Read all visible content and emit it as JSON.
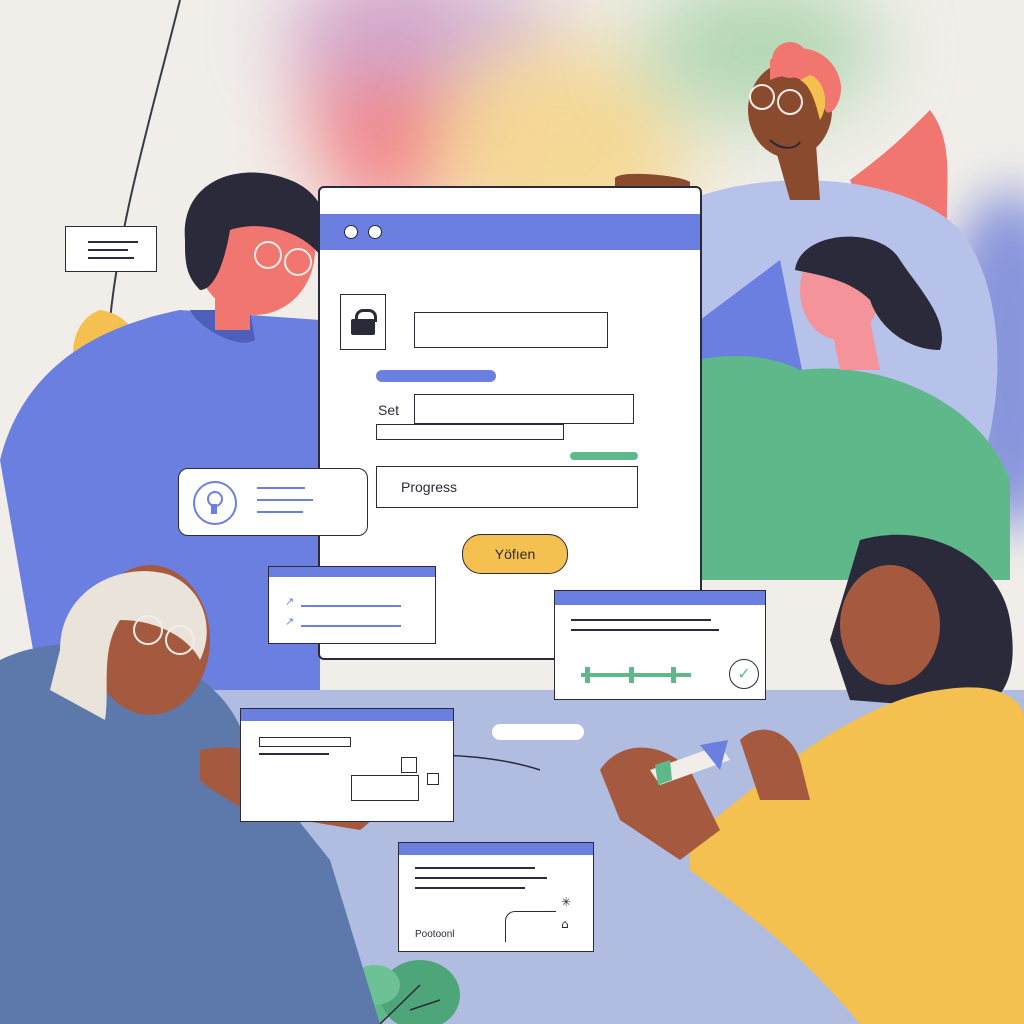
{
  "palette": {
    "background": "#f1eee9",
    "blue_accent": "#6b7fe0",
    "yellow_accent": "#f4c150",
    "green_accent": "#5fb88a",
    "coral_accent": "#f0766f",
    "table_lavender": "#b1bde0",
    "dark_ink": "#2a2a3a"
  },
  "main_window": {
    "field_label": "Set",
    "progress_label": "Progress",
    "button_label": "Yöfıen"
  },
  "bottom_card": {
    "caption": "Pootoonl"
  }
}
